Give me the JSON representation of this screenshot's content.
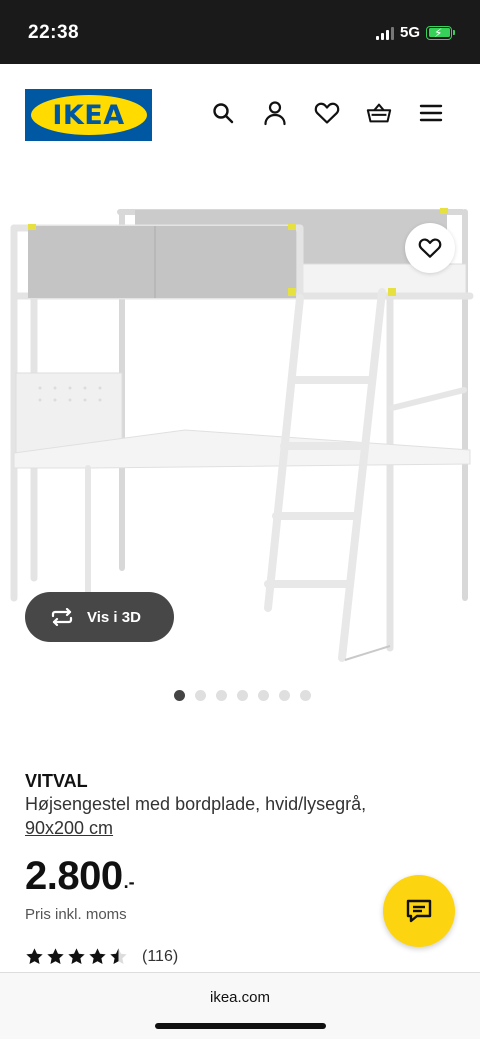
{
  "status_bar": {
    "time": "22:38",
    "network": "5G"
  },
  "header": {
    "logo_text": "IKEA"
  },
  "nav_icons": [
    "search-icon",
    "account-icon",
    "favorites-icon",
    "basket-icon",
    "menu-icon"
  ],
  "gallery": {
    "view_3d_label": "Vis i 3D",
    "image_count": 7,
    "active_index": 0
  },
  "product": {
    "name": "VITVAL",
    "description": "Højsengestel med bordplade, hvid/lysegrå,",
    "size": "90x200 cm",
    "price": "2.800",
    "price_suffix": ".-",
    "vat_note": "Pris inkl. moms",
    "rating_value": 4.5,
    "rating_count": "(116)"
  },
  "browser": {
    "url": "ikea.com"
  },
  "colors": {
    "ikea_blue": "#0058a3",
    "ikea_yellow": "#ffdb00",
    "chat_yellow": "#fcd410"
  }
}
